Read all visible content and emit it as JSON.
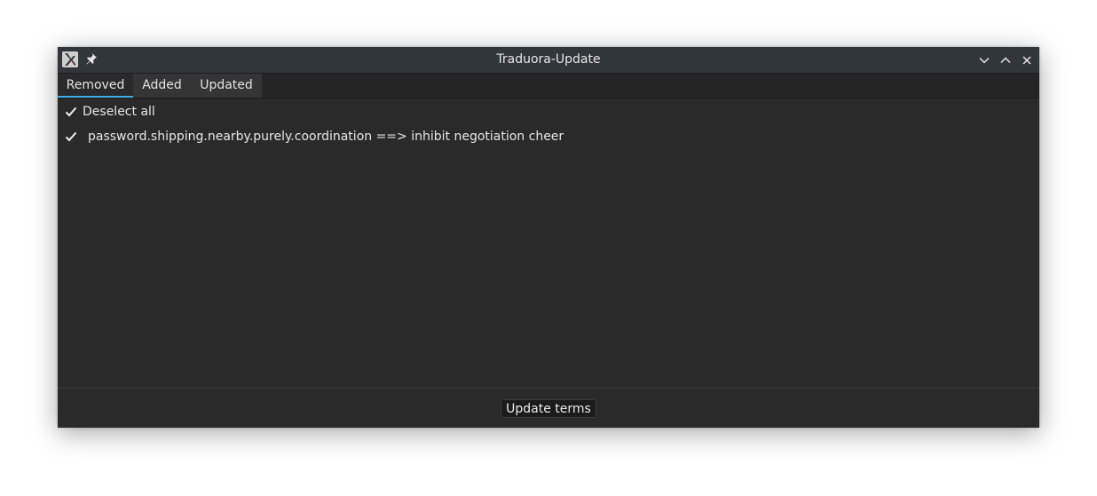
{
  "window": {
    "title": "Traduora-Update",
    "icons": {
      "app": "app-icon",
      "pin": "pin-icon",
      "minimize": "chevron-down-icon",
      "maximize": "chevron-up-icon",
      "close": "close-icon"
    }
  },
  "tabs": [
    {
      "label": "Removed",
      "active": true
    },
    {
      "label": "Added",
      "active": false
    },
    {
      "label": "Updated",
      "active": false
    }
  ],
  "content": {
    "deselect_all": {
      "label": "Deselect all",
      "checked": true
    },
    "items": [
      {
        "label": "password.shipping.nearby.purely.coordination ==> inhibit negotiation cheer",
        "checked": true
      }
    ]
  },
  "footer": {
    "update_label": "Update terms"
  },
  "colors": {
    "titlebar": "#31363b",
    "background": "#2a2a2a",
    "accent": "#3daee9",
    "text": "#e6e6e6"
  }
}
